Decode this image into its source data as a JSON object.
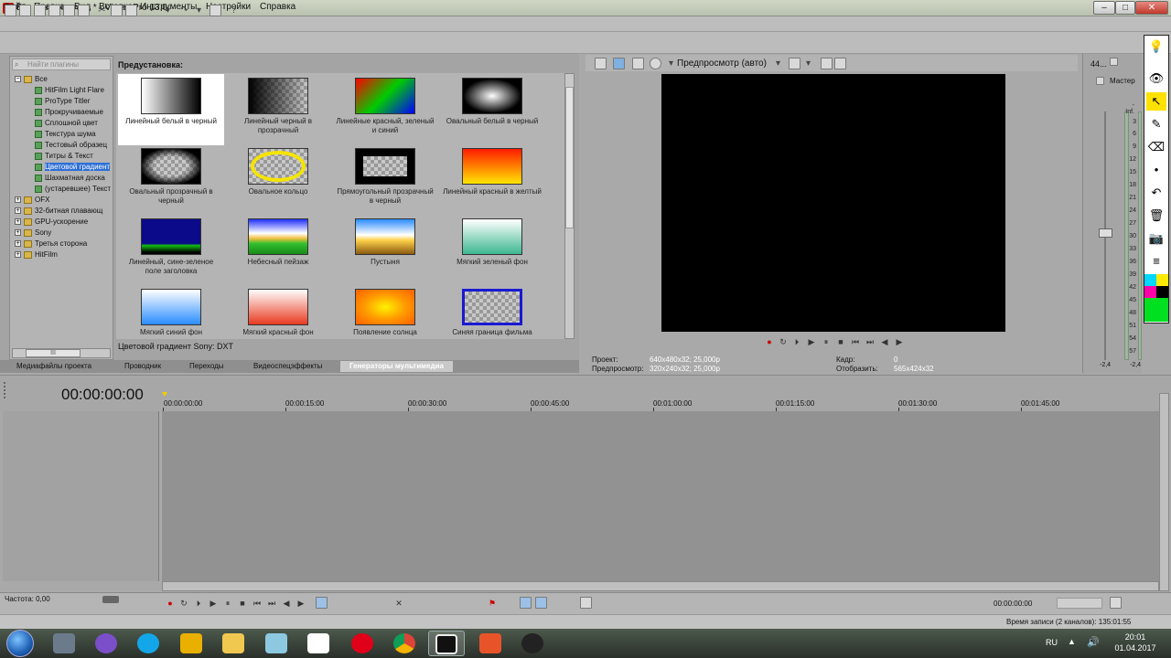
{
  "window": {
    "title": "Без названия.veg * - Vegas Pro 13.0",
    "minimize": "–",
    "maximize": "□",
    "close": "✕"
  },
  "menu": [
    "Файл",
    "Правка",
    "Вид",
    "Вставка",
    "Инструменты",
    "Настройки",
    "Справка"
  ],
  "plugin_search_placeholder": "Найти плагины",
  "tree": [
    {
      "label": "Все",
      "type": "folder",
      "expanded": true
    },
    {
      "label": "HitFilm Light Flare",
      "type": "plugin"
    },
    {
      "label": "ProType Titler",
      "type": "plugin"
    },
    {
      "label": "Прокручиваемые",
      "type": "plugin"
    },
    {
      "label": "Сплошной цвет",
      "type": "plugin"
    },
    {
      "label": "Текстура шума",
      "type": "plugin"
    },
    {
      "label": "Тестовый образец",
      "type": "plugin"
    },
    {
      "label": "Титры & Текст",
      "type": "plugin"
    },
    {
      "label": "Цветовой градиент",
      "type": "plugin",
      "selected": true
    },
    {
      "label": "Шахматная доска",
      "type": "plugin"
    },
    {
      "label": "(устаревшее) Текст",
      "type": "plugin"
    },
    {
      "label": "OFX",
      "type": "folder"
    },
    {
      "label": "32-битная плавающ",
      "type": "folder"
    },
    {
      "label": "GPU-ускорение",
      "type": "folder"
    },
    {
      "label": "Sony",
      "type": "folder"
    },
    {
      "label": "Третья сторона",
      "type": "folder"
    },
    {
      "label": "HitFilm",
      "type": "folder"
    }
  ],
  "presets_label": "Предустановка:",
  "presets": [
    {
      "label": "Линейный белый в черный",
      "thumb": "linear-white-black",
      "selected": true
    },
    {
      "label": "Линейный черный в прозрачный",
      "thumb": "linear-black-transparent"
    },
    {
      "label": "Линейные красный, зеленый и синий",
      "thumb": "linear-rgb"
    },
    {
      "label": "Овальный белый в черный",
      "thumb": "oval-white-black"
    },
    {
      "label": "Овальный прозрачный в черный",
      "thumb": "oval-transparent-black"
    },
    {
      "label": "Овальное кольцо",
      "thumb": "oval-ring"
    },
    {
      "label": "Прямоугольный прозрачный в черный",
      "thumb": "rect-transparent-black"
    },
    {
      "label": "Линейный красный в желтый",
      "thumb": "linear-red-yellow"
    },
    {
      "label": "Линейный, сине-зеленое поле заголовка",
      "thumb": "blue-green-title"
    },
    {
      "label": "Небесный пейзаж",
      "thumb": "sky-landscape"
    },
    {
      "label": "Пустыня",
      "thumb": "desert"
    },
    {
      "label": "Мягкий зеленый фон",
      "thumb": "soft-green"
    },
    {
      "label": "Мягкий синий фон",
      "thumb": "soft-blue"
    },
    {
      "label": "Мягкий красный фон",
      "thumb": "soft-red"
    },
    {
      "label": "Появление солнца",
      "thumb": "sunrise"
    },
    {
      "label": "Синяя граница фильма",
      "thumb": "blue-border"
    }
  ],
  "preset_status": "Цветовой градиент Sony: DXT",
  "dock_tabs": [
    "Медиафайлы проекта",
    "Проводник",
    "Переходы",
    "Видеоспецэффекты",
    "Генераторы мультимедиа"
  ],
  "dock_active_tab": "Генераторы мультимедиа",
  "preview": {
    "mode": "Предпросмотр (авто)",
    "project_label": "Проект:",
    "project_value": "640x480x32; 25,000p",
    "preview_label": "Предпросмотр:",
    "preview_value": "320x240x32; 25,000p",
    "frame_label": "Кадр:",
    "frame_value": "0",
    "display_label": "Отобразить:",
    "display_value": "565x424x32"
  },
  "mixer": {
    "top_label": "44...",
    "master_label": "Мастер",
    "db_marks": [
      "-Inf.",
      "3",
      "6",
      "9",
      "12",
      "15",
      "18",
      "21",
      "24",
      "27",
      "30",
      "33",
      "36",
      "39",
      "42",
      "45",
      "48",
      "51",
      "54",
      "57"
    ],
    "left_level": "-2,4",
    "right_level": "-2,4"
  },
  "timeline": {
    "timecode": "00:00:00:00",
    "ruler": [
      "00:00:00:00",
      "00:00:15:00",
      "00:00:30:00",
      "00:00:45:00",
      "00:01:00:00",
      "00:01:15:00",
      "00:01:30:00",
      "00:01:45:00"
    ],
    "rate": "Частота: 0,00",
    "end_time": "00:00:00:00"
  },
  "status": {
    "record_time": "Время записи (2 каналов): 135:01:55"
  },
  "taskbar": {
    "apps": [
      "windows-explorer",
      "keyboard",
      "viber",
      "skype",
      "totalcmd",
      "folder",
      "notepad",
      "onenote",
      "opera",
      "chrome",
      "vegas",
      "office",
      "lightshot"
    ],
    "lang": "RU",
    "time": "20:01",
    "date": "01.04.2017"
  },
  "colors": {
    "selection": "#2f6fd6",
    "panel": "#a9a9a9",
    "accent": "#fde200"
  }
}
